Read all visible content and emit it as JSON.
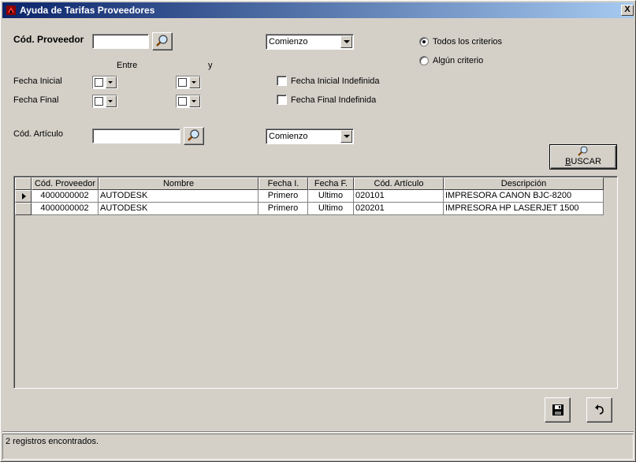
{
  "window": {
    "title": "Ayuda de Tarifas Proveedores",
    "close_label": "X"
  },
  "form": {
    "cod_proveedor_label": "Cód. Proveedor",
    "cod_proveedor_value": "",
    "proveedor_match": "Comienzo",
    "entre_label": "Entre",
    "y_label": "y",
    "fecha_inicial_label": "Fecha Inicial",
    "fecha_final_label": "Fecha Final",
    "fecha_inicial_indef_label": "Fecha Inicial Indefinida",
    "fecha_final_indef_label": "Fecha Final Indefinida",
    "fecha_inicial_indef_checked": false,
    "fecha_final_indef_checked": false,
    "cod_articulo_label": "Cód. Artículo",
    "cod_articulo_value": "",
    "articulo_match": "Comienzo",
    "radio_todos_label": "Todos los criterios",
    "radio_alguno_label": "Algún criterio",
    "selected_criterion": "todos",
    "buscar_label_prefix": "B",
    "buscar_label_rest": "USCAR"
  },
  "grid": {
    "columns": [
      "Cód. Proveedor",
      "Nombre",
      "Fecha I.",
      "Fecha F.",
      "Cód. Artículo",
      "Descripción"
    ],
    "rows": [
      [
        "4000000002",
        "AUTODESK",
        "Primero",
        "Ultimo",
        "020101",
        "IMPRESORA CANON BJC-8200"
      ],
      [
        "4000000002",
        "AUTODESK",
        "Primero",
        "Ultimo",
        "020201",
        "IMPRESORA HP LASERJET 1500"
      ]
    ],
    "selected_row": 0
  },
  "icons": {
    "app": "app-icon",
    "search": "magnifier-icon",
    "save": "floppy-disk-icon",
    "undo": "undo-arrow-icon"
  },
  "status": {
    "text": "2 registros encontrados."
  },
  "colors": {
    "titlebar_start": "#0a246a",
    "titlebar_end": "#a6caf0",
    "face": "#d4d0c8"
  }
}
